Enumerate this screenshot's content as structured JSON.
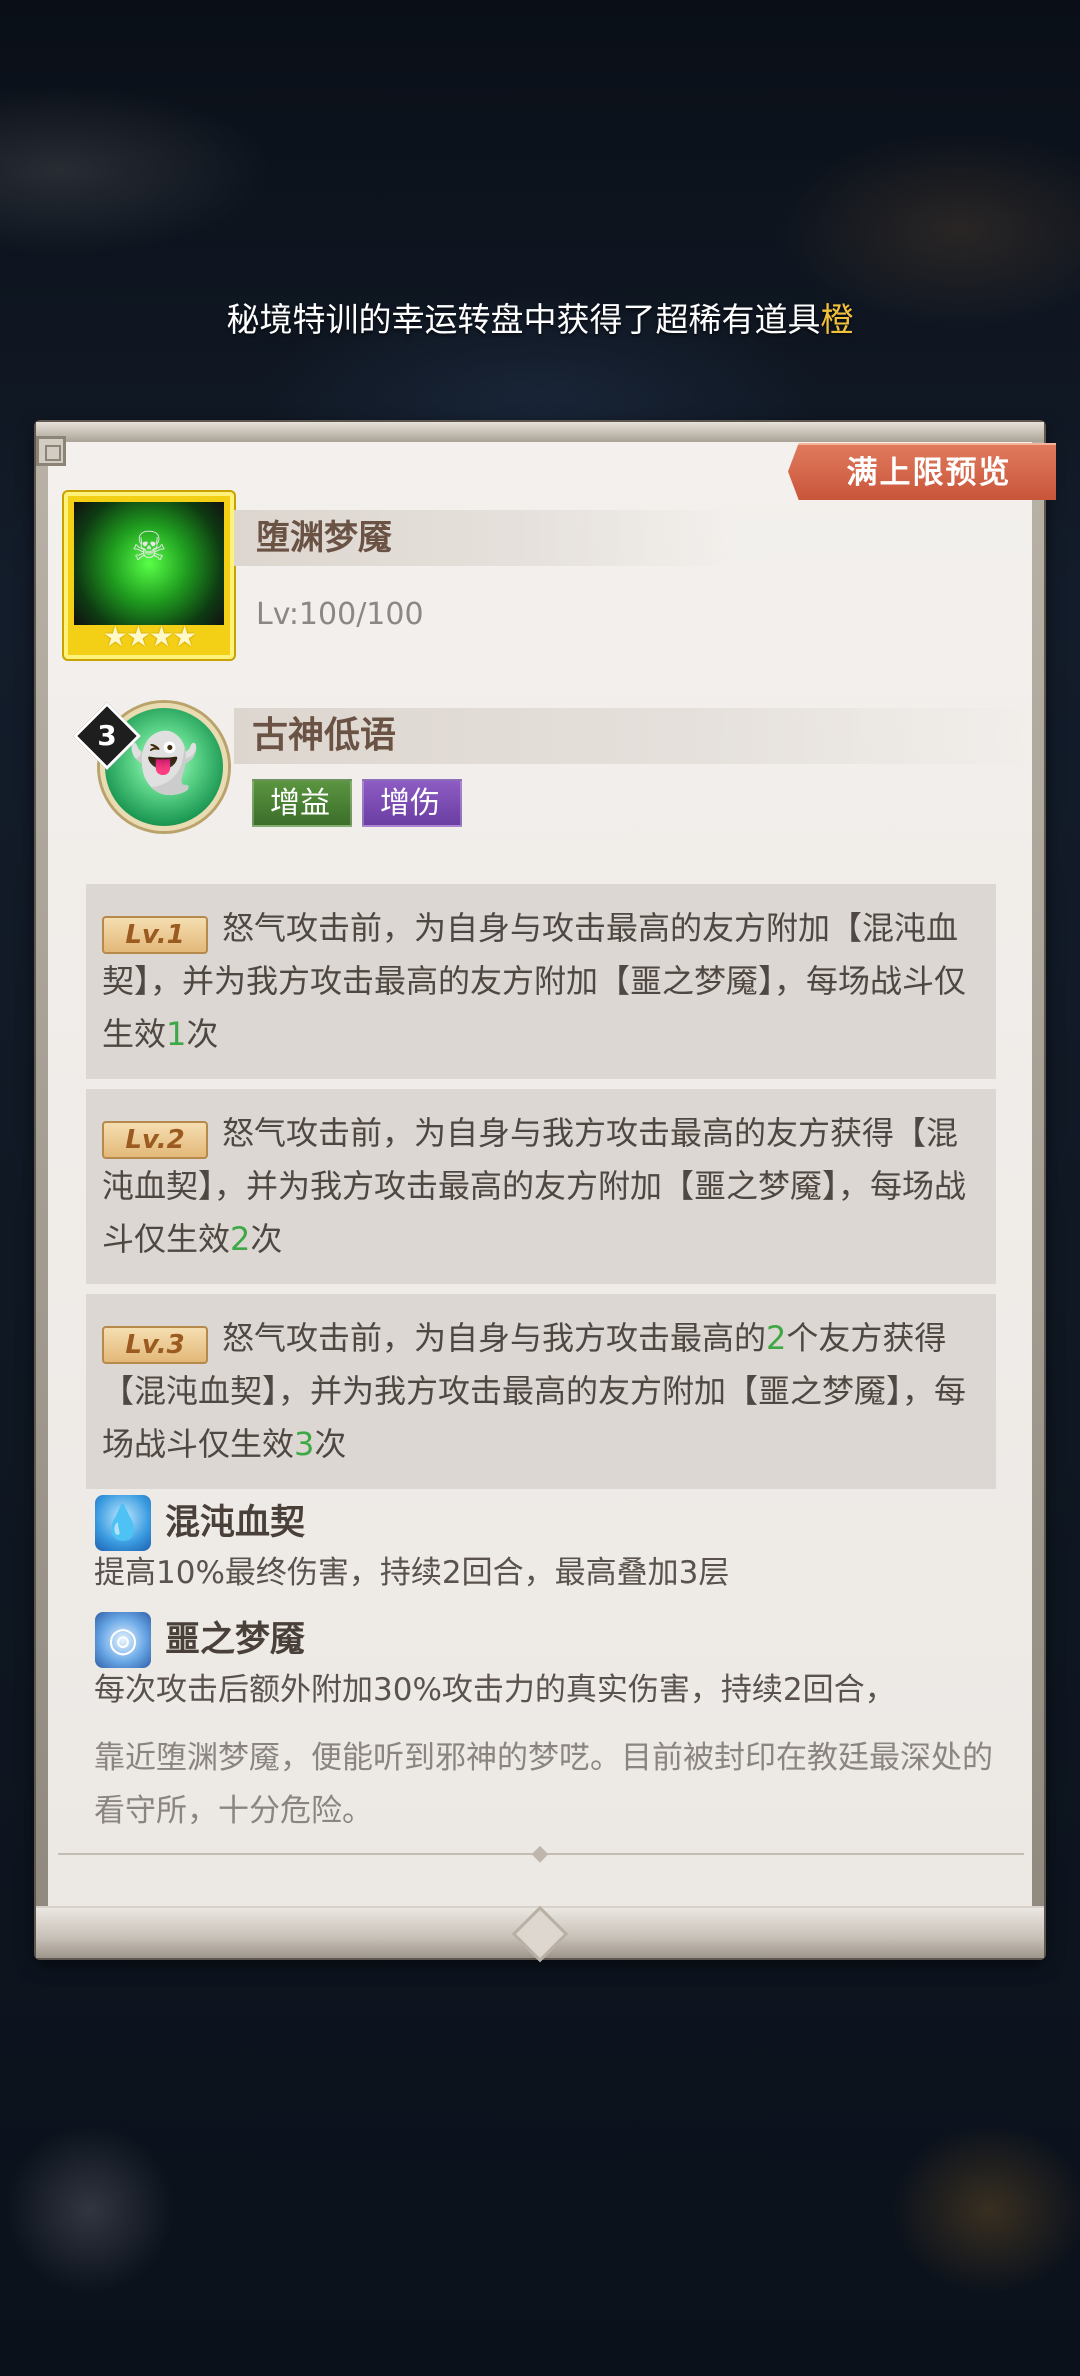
{
  "marquee": {
    "text": "秘境特训的幸运转盘中获得了超稀有道具",
    "highlight": "橙"
  },
  "ribbon": {
    "label": "满上限预览"
  },
  "item": {
    "name": "堕渊梦魇",
    "level": "Lv:100/100",
    "stars": "★★★★"
  },
  "skill": {
    "badge": "3",
    "name": "古神低语",
    "tags": [
      "增益",
      "增伤"
    ]
  },
  "levels": [
    {
      "badge": "Lv.1",
      "text_before": "怒气攻击前，为自身与攻击最高的友方附加【混沌血契】，并为我方攻击最高的友方附加【噩之梦魇】，每场战斗仅生效",
      "count": "1",
      "text_after": "次"
    },
    {
      "badge": "Lv.2",
      "text_before": "怒气攻击前，为自身与我方攻击最高的友方获得【混沌血契】，并为我方攻击最高的友方附加【噩之梦魇】，每场战斗仅生效",
      "count": "2",
      "text_after": "次"
    },
    {
      "badge": "Lv.3",
      "text_a": "怒气攻击前，为自身与我方攻击最高的",
      "num_a": "2",
      "text_b": "个友方获得【混沌血契】，并为我方攻击最高的友方附加【噩之梦魇】，每场战斗仅生效",
      "count": "3",
      "text_after": "次"
    }
  ],
  "effects": [
    {
      "icon": "water-drop-icon",
      "title": "混沌血契",
      "desc": "提高10%最终伤害，持续2回合，最高叠加3层"
    },
    {
      "icon": "eye-icon",
      "title": "噩之梦魇",
      "desc": "每次攻击后额外附加30%攻击力的真实伤害，持续2回合，"
    }
  ],
  "flavor": "靠近堕渊梦魇，便能听到邪神的梦呓。目前被封印在教廷最深处的看守所，十分危险。"
}
